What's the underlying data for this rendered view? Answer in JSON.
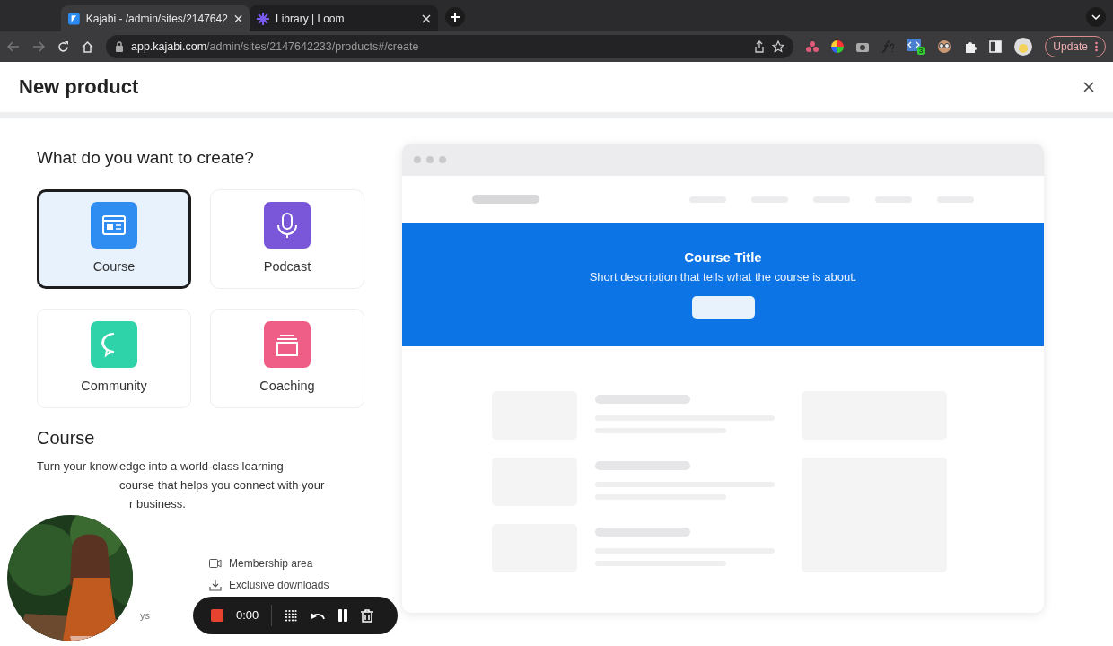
{
  "browser": {
    "tabs": [
      {
        "title": "Kajabi - /admin/sites/2147642",
        "kind": "kajabi",
        "selected": true
      },
      {
        "title": "Library | Loom",
        "kind": "loom",
        "selected": false
      }
    ],
    "address": {
      "host": "app.kajabi.com",
      "path": "/admin/sites/2147642233/products#/create"
    },
    "extension_badge": "3",
    "update_button": "Update"
  },
  "page": {
    "title": "New product",
    "question": "What do you want to create?",
    "product_types": [
      {
        "label": "Course",
        "kind": "course",
        "color": "#2f8cf0",
        "selected": true
      },
      {
        "label": "Podcast",
        "kind": "podcast",
        "color": "#7a57d8",
        "selected": false
      },
      {
        "label": "Community",
        "kind": "community",
        "color": "#2fd3aa",
        "selected": false
      },
      {
        "label": "Coaching",
        "kind": "coaching",
        "color": "#ee5e86",
        "selected": false
      }
    ],
    "detail": {
      "title": "Course",
      "description_lines": [
        "Turn your knowledge into a world-class learning",
        "course that helps you connect with your",
        "r business."
      ],
      "features": [
        {
          "label": "Membership area",
          "kind": "video"
        },
        {
          "label": "Exclusive downloads",
          "kind": "download"
        }
      ],
      "cut_fragment": "ys"
    }
  },
  "preview": {
    "title": "Course Title",
    "description": "Short description that tells what the course is about."
  },
  "recorder": {
    "time": "0:00"
  }
}
